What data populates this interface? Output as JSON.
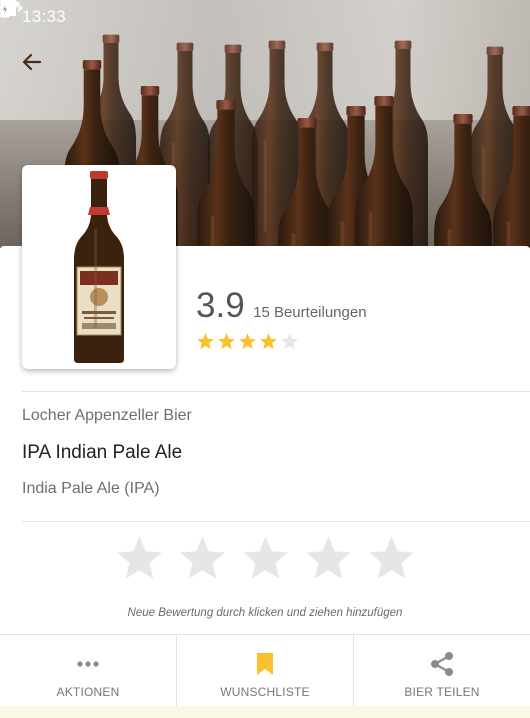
{
  "status_bar": {
    "time": "13:33",
    "left_icons": [
      "pinwheel-icon",
      "parking-p-icon"
    ],
    "right_icons": [
      "vibrate-icon",
      "wifi-icon",
      "signal-icon",
      "battery-icon"
    ]
  },
  "header": {
    "back_icon": "arrow-left-icon",
    "image": "beer-bottles-photo"
  },
  "product": {
    "thumbnail": "beer-bottle-image",
    "rating_value": "3.9",
    "rating_count_label": "15 Beurteilungen",
    "rating_stars": 4,
    "rating_max": 5,
    "brewery": "Locher Appenzeller Bier",
    "name": "IPA Indian Pale Ale",
    "style": "India Pale Ale (IPA)"
  },
  "user_rating": {
    "stars": 5,
    "selected": 0,
    "hint": "Neue Bewertung durch klicken und ziehen hinzufügen"
  },
  "actions": [
    {
      "label": "AKTIONEN",
      "icon": "more-dots-icon"
    },
    {
      "label": "WUNSCHLISTE",
      "icon": "bookmark-icon"
    },
    {
      "label": "BIER TEILEN",
      "icon": "share-icon"
    }
  ],
  "colors": {
    "star_filled": "#fbc02d",
    "star_empty": "#e6e6e6",
    "bookmark": "#fbc02d",
    "icon_gray": "#8a8a8a"
  }
}
